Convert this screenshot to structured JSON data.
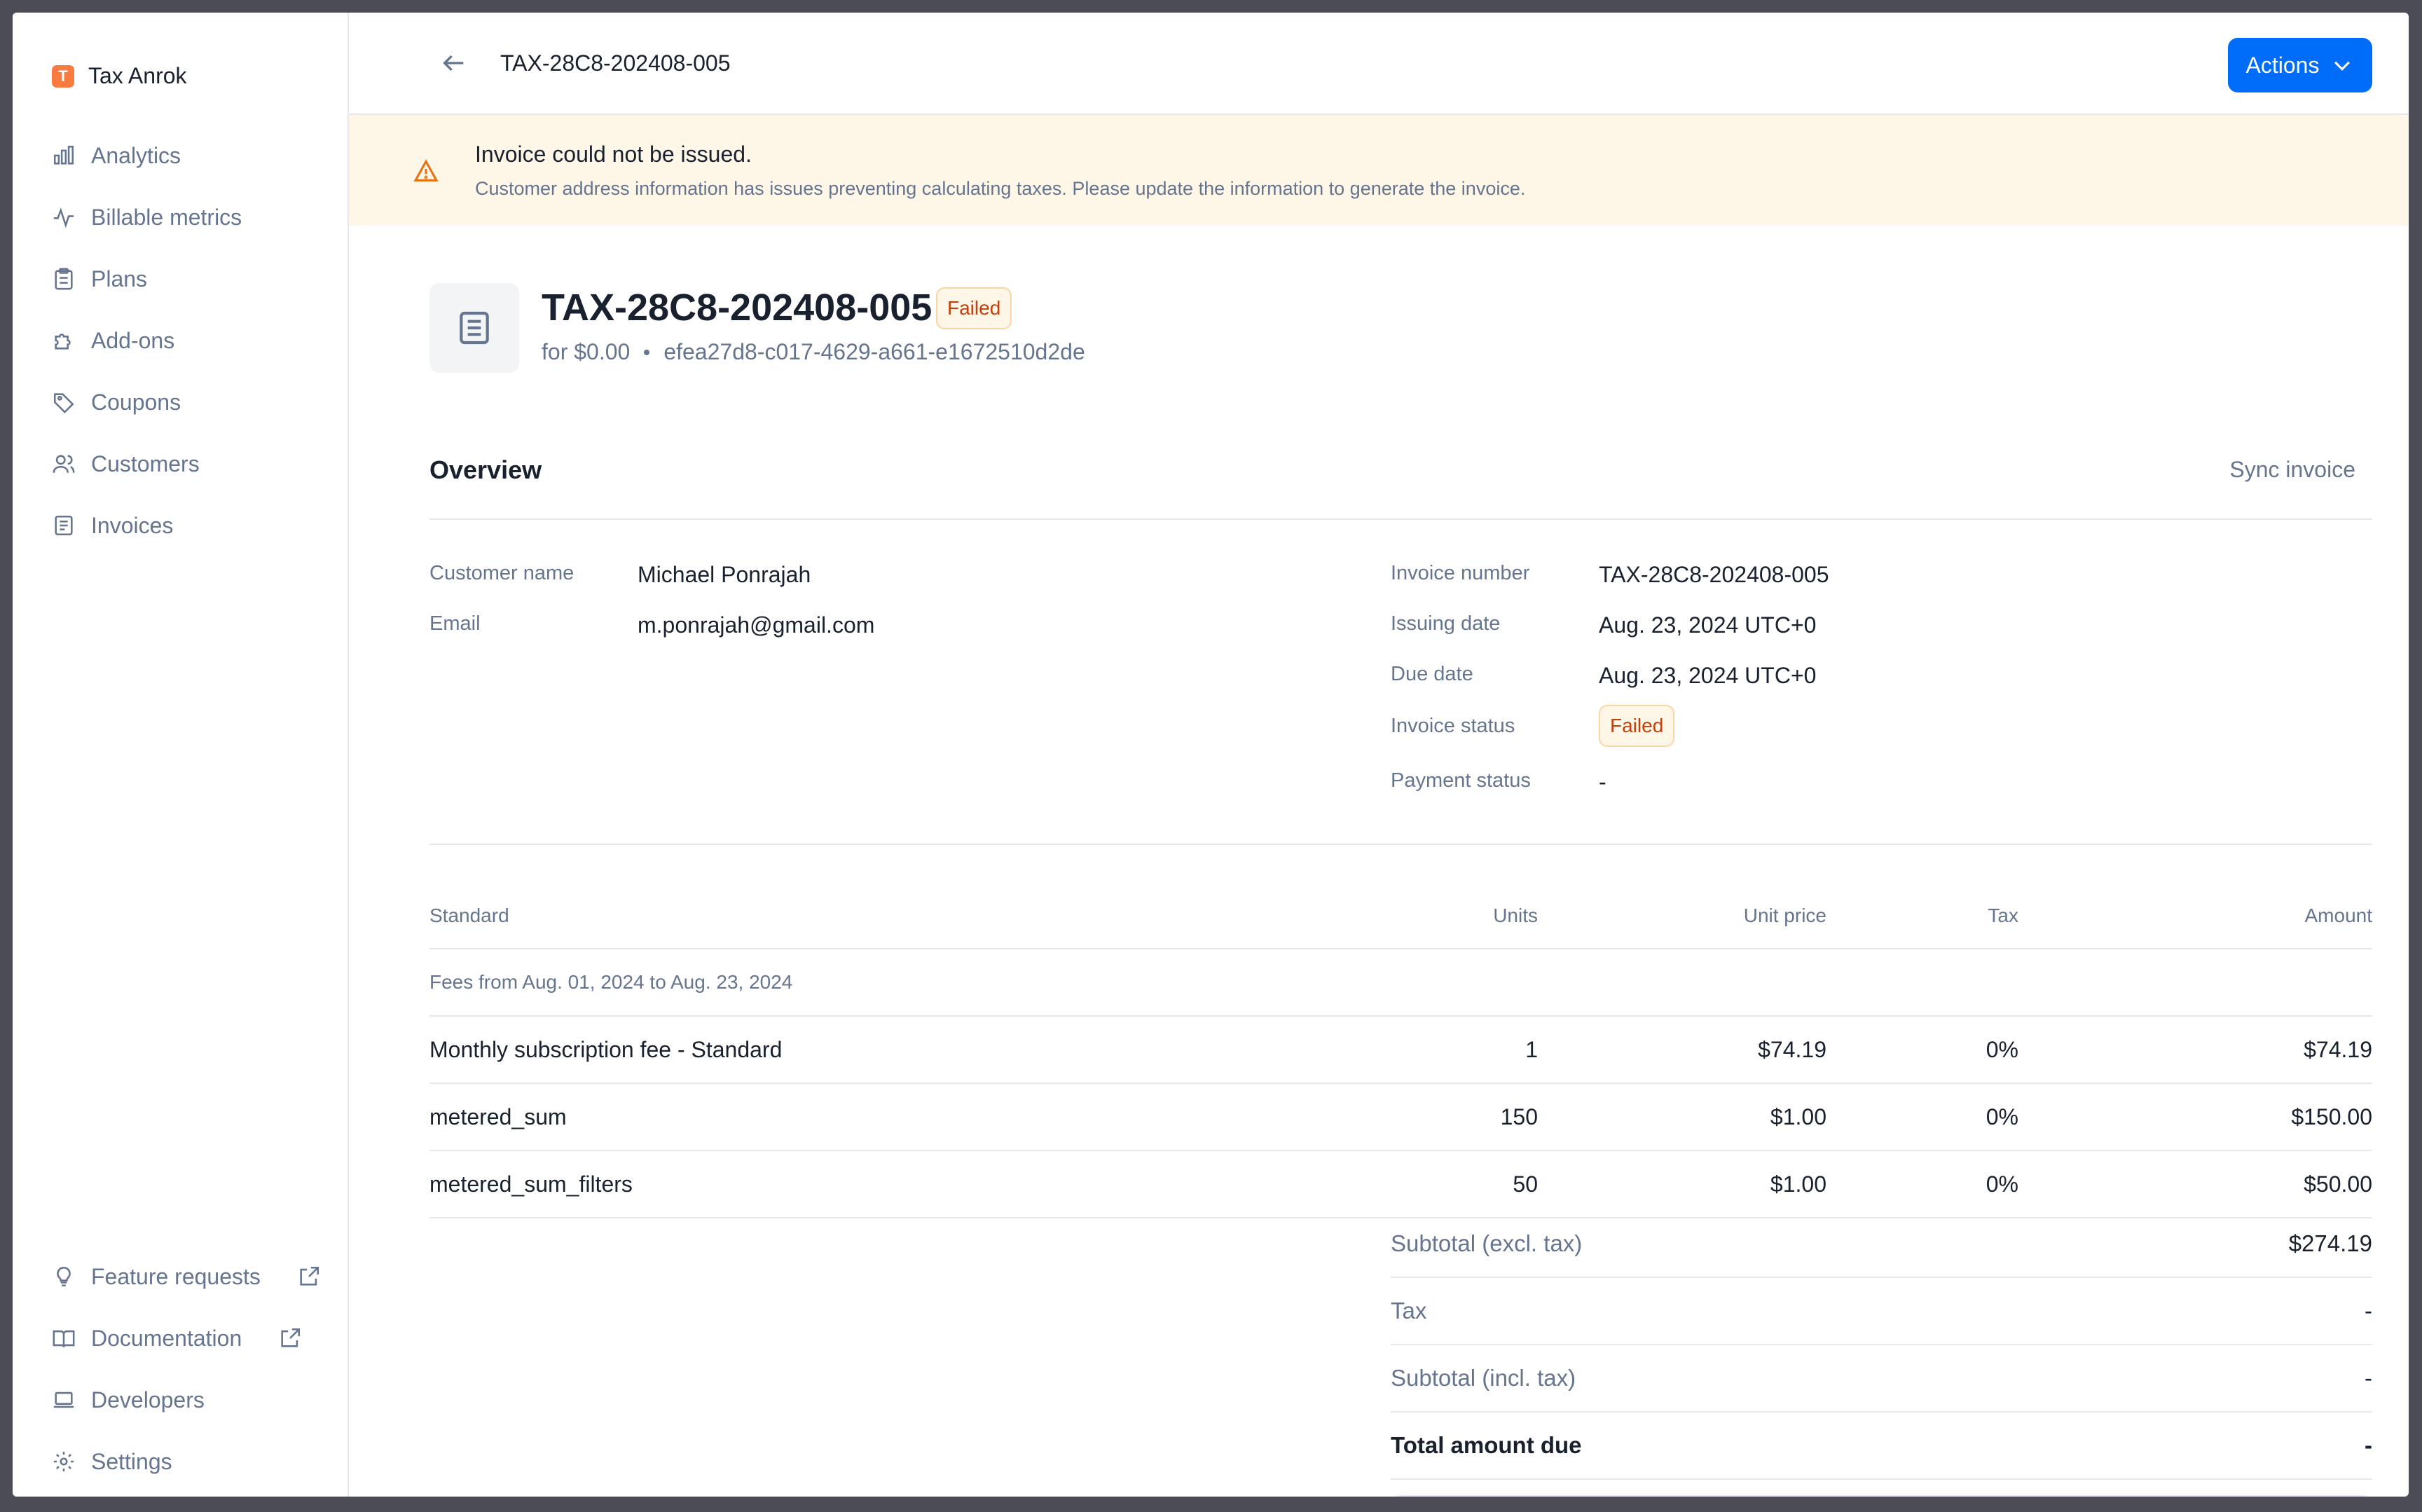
{
  "org": {
    "initial": "T",
    "name": "Tax Anrok"
  },
  "nav": [
    {
      "label": "Analytics"
    },
    {
      "label": "Billable metrics"
    },
    {
      "label": "Plans"
    },
    {
      "label": "Add-ons"
    },
    {
      "label": "Coupons"
    },
    {
      "label": "Customers"
    },
    {
      "label": "Invoices"
    }
  ],
  "nav_bottom": [
    {
      "label": "Feature requests"
    },
    {
      "label": "Documentation"
    },
    {
      "label": "Developers"
    },
    {
      "label": "Settings"
    }
  ],
  "topbar": {
    "title": "TAX-28C8-202408-005",
    "actions_label": "Actions"
  },
  "banner": {
    "title": "Invoice could not be issued.",
    "text": "Customer address information has issues preventing calculating taxes. Please update the information to generate the invoice."
  },
  "invoice": {
    "number": "TAX-28C8-202408-005",
    "status": "Failed",
    "amount_text": "for $0.00",
    "id": "efea27d8-c017-4629-a661-e1672510d2de"
  },
  "overview": {
    "title": "Overview",
    "sync_label": "Sync invoice",
    "customer_name_label": "Customer name",
    "customer_name": "Michael Ponrajah",
    "email_label": "Email",
    "email": "m.ponrajah@gmail.com",
    "invoice_number_label": "Invoice number",
    "invoice_number": "TAX-28C8-202408-005",
    "issuing_date_label": "Issuing date",
    "issuing_date": "Aug. 23, 2024 UTC+0",
    "due_date_label": "Due date",
    "due_date": "Aug. 23, 2024 UTC+0",
    "invoice_status_label": "Invoice status",
    "invoice_status": "Failed",
    "payment_status_label": "Payment status",
    "payment_status": "-"
  },
  "fees": {
    "headers": {
      "name": "Standard",
      "units": "Units",
      "unit_price": "Unit price",
      "tax": "Tax",
      "amount": "Amount"
    },
    "period": "Fees from Aug. 01, 2024 to Aug. 23, 2024",
    "rows": [
      {
        "name": "Monthly subscription fee - Standard",
        "units": "1",
        "unit_price": "$74.19",
        "tax": "0%",
        "amount": "$74.19"
      },
      {
        "name": "metered_sum",
        "units": "150",
        "unit_price": "$1.00",
        "tax": "0%",
        "amount": "$150.00"
      },
      {
        "name": "metered_sum_filters",
        "units": "50",
        "unit_price": "$1.00",
        "tax": "0%",
        "amount": "$50.00"
      }
    ]
  },
  "totals": [
    {
      "label": "Subtotal (excl. tax)",
      "value": "$274.19"
    },
    {
      "label": "Tax",
      "value": "-"
    },
    {
      "label": "Subtotal (incl. tax)",
      "value": "-"
    },
    {
      "label": "Total amount due",
      "value": "-"
    }
  ],
  "colors": {
    "accent": "#006cfa",
    "warning_bg": "#fef6e7",
    "warning_text": "#c2410c",
    "org_logo": "#f97b3f"
  }
}
